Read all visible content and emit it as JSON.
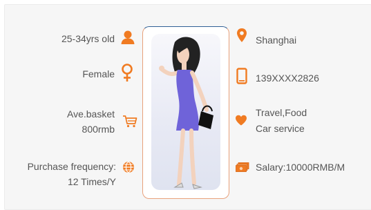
{
  "colors": {
    "accent": "#f07b22",
    "text": "#555555",
    "card_bg": "#f6f6f6",
    "frame_top": "#2f5f94",
    "frame_bottom": "#e8a07a"
  },
  "left": {
    "age": "25-34yrs old",
    "gender": "Female",
    "basket_line1": "Ave.basket",
    "basket_line2": "800rmb",
    "freq_line1": "Purchase frequency:",
    "freq_line2": "12 Times/Y"
  },
  "right": {
    "city": "Shanghai",
    "phone": "139XXXX2826",
    "interest_line1": "Travel,Food",
    "interest_line2": "Car service",
    "salary": "Salary:10000RMB/M"
  },
  "icons": {
    "age": "person-icon",
    "gender": "female-icon",
    "basket": "shopping-cart-icon",
    "frequency": "globe-icon",
    "city": "location-pin-icon",
    "phone": "mobile-phone-icon",
    "interest": "heart-icon",
    "salary": "money-icon"
  }
}
